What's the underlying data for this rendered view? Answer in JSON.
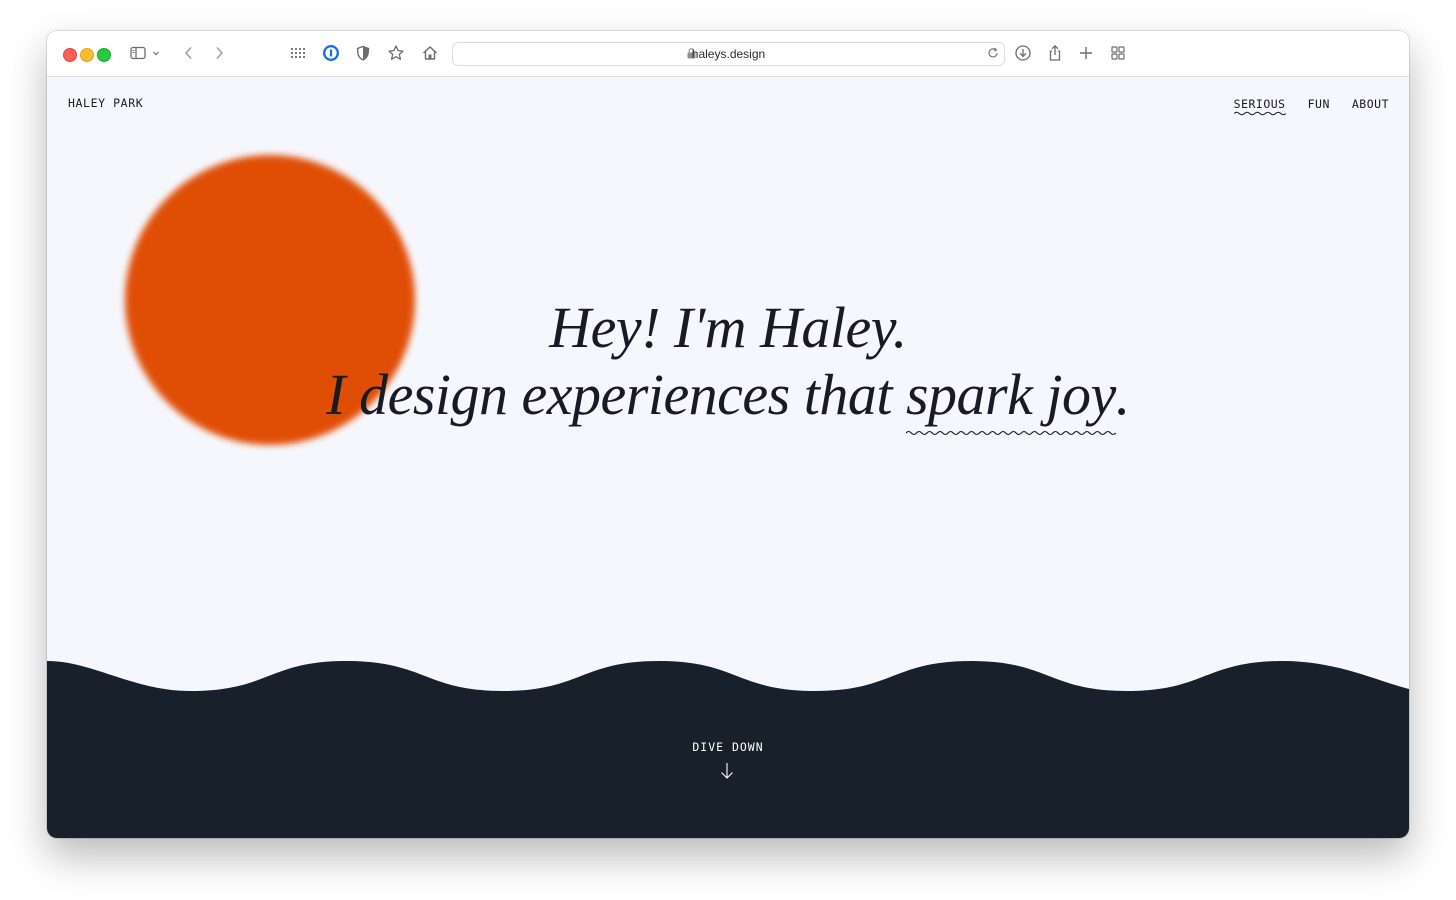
{
  "browser": {
    "url": "haleys.design"
  },
  "site": {
    "brand": "HALEY PARK",
    "nav": [
      {
        "label": "SERIOUS",
        "active": true
      },
      {
        "label": "FUN",
        "active": false
      },
      {
        "label": "ABOUT",
        "active": false
      }
    ],
    "hero_line1": "Hey! I'm Haley.",
    "hero_line2_prefix": "I design experiences that ",
    "hero_highlight": "spark joy",
    "hero_line2_suffix": ".",
    "cta": "DIVE DOWN"
  },
  "colors": {
    "accent_orange": "#e04e06",
    "page_background": "#f6f7fc",
    "navy": "#18202b",
    "text": "#161b24"
  },
  "icons": [
    "sidebar-icon",
    "chevron-down-icon",
    "back-arrow-icon",
    "forward-arrow-icon",
    "grid-icon",
    "password-manager-icon",
    "shield-icon",
    "star-icon",
    "home-icon",
    "lock-icon",
    "reload-icon",
    "download-icon",
    "share-icon",
    "plus-icon",
    "tab-overview-icon",
    "arrow-down-icon"
  ]
}
